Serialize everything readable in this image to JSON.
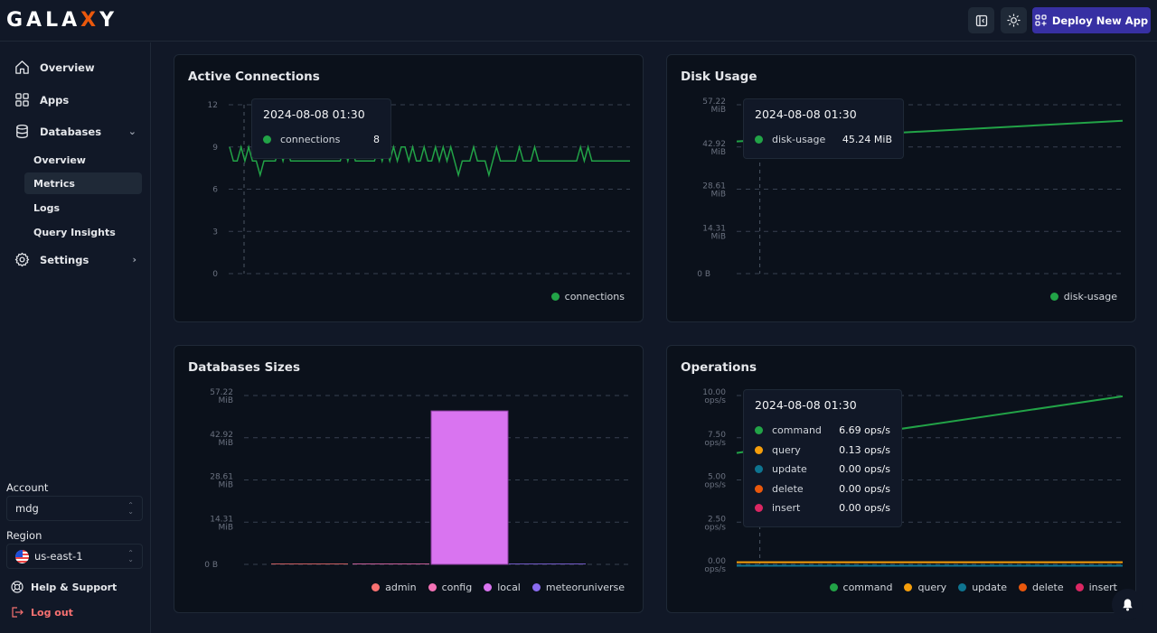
{
  "app": {
    "logo_prefix": "GALA",
    "logo_x": "X",
    "logo_suffix": "Y"
  },
  "topbar": {
    "sidebar_toggle_icon": "sidebar-collapse-icon",
    "theme_icon": "sun-icon",
    "deploy_label": "Deploy New App"
  },
  "sidebar": {
    "items": [
      {
        "label": "Overview",
        "icon": "home-icon"
      },
      {
        "label": "Apps",
        "icon": "grid-icon"
      },
      {
        "label": "Databases",
        "icon": "database-icon",
        "expanded": true
      },
      {
        "label": "Settings",
        "icon": "gear-icon"
      }
    ],
    "db_subitems": [
      {
        "label": "Overview",
        "active": false
      },
      {
        "label": "Metrics",
        "active": true
      },
      {
        "label": "Logs",
        "active": false
      },
      {
        "label": "Query Insights",
        "active": false
      }
    ],
    "account_label": "Account",
    "account_value": "mdg",
    "region_label": "Region",
    "region_value": "us-east-1",
    "help_label": "Help & Support",
    "logout_label": "Log out",
    "logout_color": "#f87171"
  },
  "cards": {
    "connections": {
      "title": "Active Connections",
      "tooltip": {
        "time": "2024-08-08 01:30",
        "rows": [
          {
            "name": "connections",
            "value": "8",
            "color": "#22a347"
          }
        ]
      }
    },
    "disk": {
      "title": "Disk Usage",
      "tooltip": {
        "time": "2024-08-08 01:30",
        "rows": [
          {
            "name": "disk-usage",
            "value": "45.24 MiB",
            "color": "#22a347"
          }
        ]
      }
    },
    "dbsizes": {
      "title": "Databases Sizes"
    },
    "ops": {
      "title": "Operations",
      "tooltip": {
        "time": "2024-08-08 01:30",
        "rows": [
          {
            "name": "command",
            "value": "6.69 ops/s",
            "color": "#22a347"
          },
          {
            "name": "query",
            "value": "0.13 ops/s",
            "color": "#f59e0b"
          },
          {
            "name": "update",
            "value": "0.00 ops/s",
            "color": "#0e7490"
          },
          {
            "name": "delete",
            "value": "0.00 ops/s",
            "color": "#ea580c"
          },
          {
            "name": "insert",
            "value": "0.00 ops/s",
            "color": "#db2763"
          }
        ]
      }
    }
  },
  "chart_data": [
    {
      "id": "connections",
      "type": "line",
      "title": "Active Connections",
      "ylim": [
        0,
        12
      ],
      "yticks": [
        "0",
        "3",
        "6",
        "9",
        "12"
      ],
      "grid": true,
      "legend_position": "bottom-right",
      "series": [
        {
          "name": "connections",
          "color": "#22a347",
          "values": [
            9,
            8,
            8,
            9,
            8,
            9,
            8,
            8,
            7,
            8,
            8,
            8,
            8,
            9,
            8,
            9,
            8,
            8,
            8,
            8,
            8,
            8,
            8,
            8,
            8,
            8,
            8,
            8,
            8,
            8,
            9,
            8,
            9,
            8,
            8,
            8,
            8,
            8,
            8,
            9,
            8,
            9,
            8,
            9,
            8,
            9,
            9,
            8,
            9,
            8,
            8,
            9,
            8,
            8,
            9,
            8,
            9,
            8,
            9,
            8,
            7,
            8,
            8,
            8,
            9,
            8,
            8,
            8,
            7,
            8,
            9,
            8,
            8,
            8,
            8,
            8,
            9,
            8,
            8,
            8,
            9,
            8,
            8,
            8,
            8,
            8,
            8,
            8,
            8,
            8,
            8,
            8,
            9,
            8,
            9,
            8,
            8,
            8,
            8,
            8,
            8,
            8,
            8,
            8,
            8,
            8
          ]
        }
      ],
      "hover_index": 8
    },
    {
      "id": "disk",
      "type": "line",
      "title": "Disk Usage",
      "ylim": [
        0,
        57.22
      ],
      "yticks": [
        "0 B",
        "14.31 MiB",
        "28.61 MiB",
        "42.92 MiB",
        "57.22 MiB"
      ],
      "grid": true,
      "legend_position": "bottom-right",
      "series": [
        {
          "name": "disk-usage",
          "color": "#22a347",
          "x": [
            0,
            1
          ],
          "values": [
            44.8,
            51.8
          ]
        }
      ],
      "hover_x": 0.06
    },
    {
      "id": "dbsizes",
      "type": "bar",
      "title": "Databases Sizes",
      "ylim": [
        0,
        57.22
      ],
      "yticks": [
        "0 B",
        "14.31 MiB",
        "28.61 MiB",
        "42.92 MiB",
        "57.22 MiB"
      ],
      "grid": true,
      "legend_position": "bottom-right",
      "categories": [
        "admin",
        "config",
        "local",
        "meteoruniverse"
      ],
      "colors": [
        "#f87171",
        "#f472b6",
        "#d974f0",
        "#8b6cf0"
      ],
      "values": [
        0,
        0,
        52.0,
        0.1
      ]
    },
    {
      "id": "ops",
      "type": "line",
      "title": "Operations",
      "ylim": [
        0,
        10
      ],
      "yticks": [
        "0.00 ops/s",
        "2.50 ops/s",
        "5.00 ops/s",
        "7.50 ops/s",
        "10.00 ops/s"
      ],
      "grid": true,
      "legend_position": "bottom-right",
      "series": [
        {
          "name": "command",
          "color": "#22a347",
          "x": [
            0,
            1
          ],
          "values": [
            6.6,
            9.95
          ]
        },
        {
          "name": "query",
          "color": "#f59e0b",
          "x": [
            0,
            1
          ],
          "values": [
            0.13,
            0.13
          ]
        },
        {
          "name": "update",
          "color": "#0e7490",
          "x": [
            0,
            1
          ],
          "values": [
            0,
            0
          ]
        },
        {
          "name": "delete",
          "color": "#ea580c",
          "x": [
            0,
            1
          ],
          "values": [
            0,
            0
          ]
        },
        {
          "name": "insert",
          "color": "#db2763",
          "x": [
            0,
            1
          ],
          "values": [
            0,
            0
          ]
        }
      ],
      "hover_x": 0.06
    }
  ],
  "bell_icon": "bell-icon"
}
